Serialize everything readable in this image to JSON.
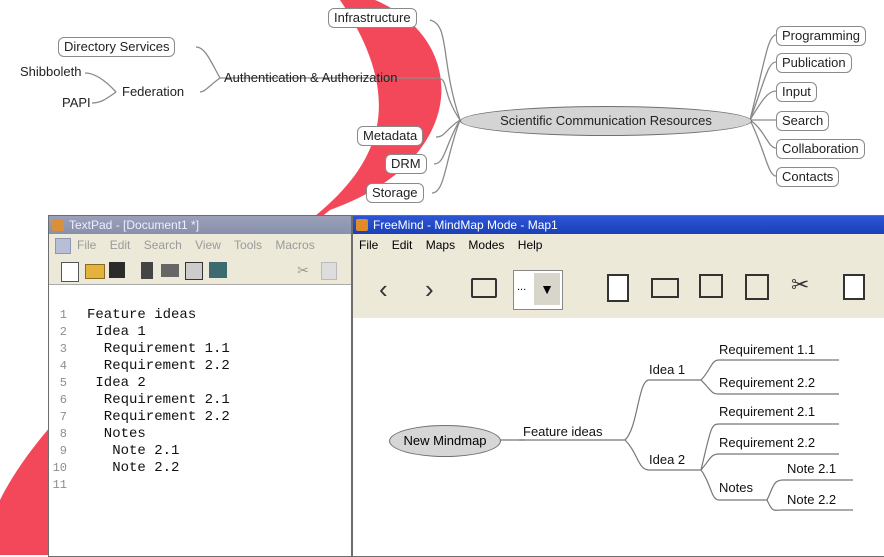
{
  "top_mindmap": {
    "root": "Scientific Communication Resources",
    "left_nodes": {
      "infrastructure": "Infrastructure",
      "directory_services": "Directory Services",
      "shibboleth": "Shibboleth",
      "papi": "PAPI",
      "federation": "Federation",
      "auth": "Authentication & Authorization",
      "metadata": "Metadata",
      "drm": "DRM",
      "storage": "Storage"
    },
    "right_nodes": [
      "Programming",
      "Publication",
      "Input",
      "Search",
      "Collaboration",
      "Contacts"
    ]
  },
  "textpad": {
    "title": "TextPad - [Document1 *]",
    "menu": [
      "File",
      "Edit",
      "Search",
      "View",
      "Tools",
      "Macros"
    ],
    "toolbar_icons": [
      "new-file-icon",
      "open-folder-icon",
      "save-icon",
      "page-icon",
      "print-icon",
      "print-preview-icon",
      "spell-icon",
      "cut-icon",
      "copy-icon"
    ],
    "lines": [
      {
        "num": "1",
        "text": "Feature ideas"
      },
      {
        "num": "2",
        "text": " Idea 1"
      },
      {
        "num": "3",
        "text": "  Requirement 1.1"
      },
      {
        "num": "4",
        "text": "  Requirement 2.2"
      },
      {
        "num": "5",
        "text": " Idea 2"
      },
      {
        "num": "6",
        "text": "  Requirement 2.1"
      },
      {
        "num": "7",
        "text": "  Requirement 2.2"
      },
      {
        "num": "8",
        "text": "  Notes"
      },
      {
        "num": "9",
        "text": "   Note 2.1"
      },
      {
        "num": "10",
        "text": "   Note 2.2"
      },
      {
        "num": "11",
        "text": ""
      }
    ]
  },
  "freemind": {
    "title": "FreeMind - MindMap Mode - Map1",
    "menu": [
      "File",
      "Edit",
      "Maps",
      "Modes",
      "Help"
    ],
    "zoom_value": "...",
    "map": {
      "root": "New Mindmap",
      "feature": "Feature ideas",
      "idea1": "Idea 1",
      "req11": "Requirement 1.1",
      "req22a": "Requirement 2.2",
      "req21": "Requirement 2.1",
      "req22b": "Requirement 2.2",
      "idea2": "Idea 2",
      "notes": "Notes",
      "note21": "Note 2.1",
      "note22": "Note 2.2"
    }
  },
  "colors": {
    "accent_ribbon": "#f0283c",
    "freemind_title": "#1f44c4",
    "textpad_title": "#9097b0"
  }
}
